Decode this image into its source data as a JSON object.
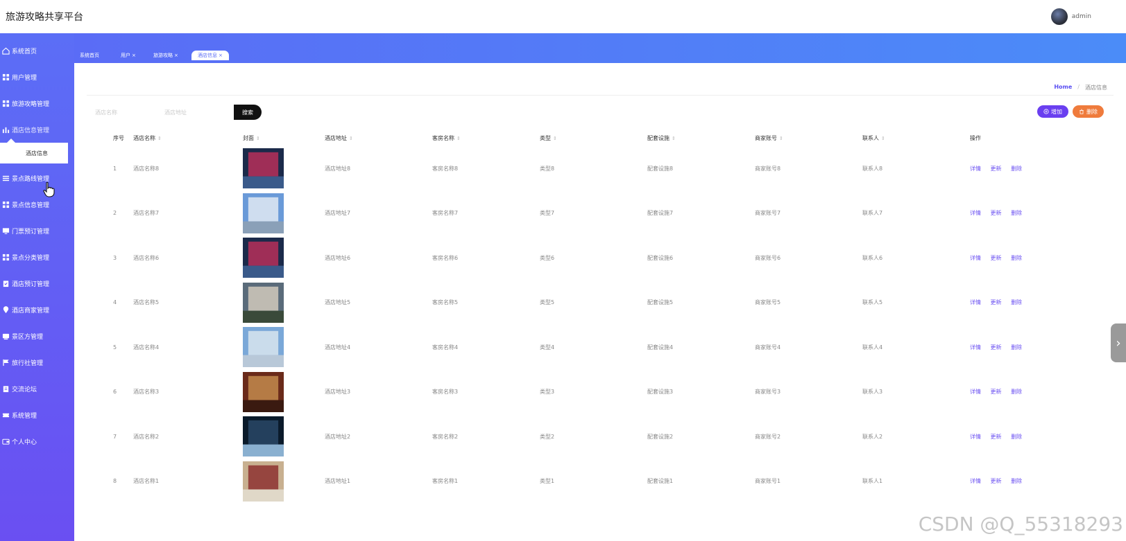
{
  "app": {
    "title": "旅游攻略共享平台",
    "user": "admin"
  },
  "sidebar": {
    "items": [
      {
        "label": "系统首页",
        "icon": "home-icon"
      },
      {
        "label": "用户管理",
        "icon": "grid-icon"
      },
      {
        "label": "旅游攻略管理",
        "icon": "grid-icon"
      },
      {
        "label": "酒店信息管理",
        "icon": "bar-chart-icon"
      },
      {
        "label": "景点路线管理",
        "icon": "list-icon"
      },
      {
        "label": "景点信息管理",
        "icon": "grid-icon"
      },
      {
        "label": "门票预订管理",
        "icon": "monitor-icon"
      },
      {
        "label": "景点分类管理",
        "icon": "grid-icon"
      },
      {
        "label": "酒店预订管理",
        "icon": "clipboard-icon"
      },
      {
        "label": "酒店商家管理",
        "icon": "location-icon"
      },
      {
        "label": "景区方管理",
        "icon": "card-icon"
      },
      {
        "label": "旅行社管理",
        "icon": "flag-icon"
      },
      {
        "label": "交流论坛",
        "icon": "clipboard-icon"
      },
      {
        "label": "系统管理",
        "icon": "ticket-icon"
      },
      {
        "label": "个人中心",
        "icon": "wallet-icon"
      }
    ],
    "submenu_label": "酒店信息"
  },
  "tabs": [
    {
      "label": "系统首页",
      "closable": false
    },
    {
      "label": "用户",
      "closable": true
    },
    {
      "label": "旅游攻略",
      "closable": true
    },
    {
      "label": "酒店信息",
      "closable": true,
      "active": true
    }
  ],
  "breadcrumb": {
    "home": "Home",
    "current": "酒店信息"
  },
  "search": {
    "name_placeholder": "酒店名称",
    "address_placeholder": "酒店地址",
    "button": "搜索"
  },
  "actions": {
    "add": "增加",
    "delete": "删除"
  },
  "table": {
    "headers": [
      "序号",
      "酒店名称",
      "封面",
      "酒店地址",
      "客房名称",
      "类型",
      "配套设施",
      "商家账号",
      "联系人",
      "操作"
    ],
    "ops": [
      "详情",
      "更新",
      "删除"
    ],
    "rows": [
      {
        "no": "1",
        "name": "酒店名称8",
        "address": "酒店地址8",
        "room": "客房名称8",
        "type": "类型8",
        "facility": "配套设施8",
        "account": "商家账号8",
        "contact": "联系人8"
      },
      {
        "no": "2",
        "name": "酒店名称7",
        "address": "酒店地址7",
        "room": "客房名称7",
        "type": "类型7",
        "facility": "配套设施7",
        "account": "商家账号7",
        "contact": "联系人7"
      },
      {
        "no": "3",
        "name": "酒店名称6",
        "address": "酒店地址6",
        "room": "客房名称6",
        "type": "类型6",
        "facility": "配套设施6",
        "account": "商家账号6",
        "contact": "联系人6"
      },
      {
        "no": "4",
        "name": "酒店名称5",
        "address": "酒店地址5",
        "room": "客房名称5",
        "type": "类型5",
        "facility": "配套设施5",
        "account": "商家账号5",
        "contact": "联系人5"
      },
      {
        "no": "5",
        "name": "酒店名称4",
        "address": "酒店地址4",
        "room": "客房名称4",
        "type": "类型4",
        "facility": "配套设施4",
        "account": "商家账号4",
        "contact": "联系人4"
      },
      {
        "no": "6",
        "name": "酒店名称3",
        "address": "酒店地址3",
        "room": "客房名称3",
        "type": "类型3",
        "facility": "配套设施3",
        "account": "商家账号3",
        "contact": "联系人3"
      },
      {
        "no": "7",
        "name": "酒店名称2",
        "address": "酒店地址2",
        "room": "客房名称2",
        "type": "类型2",
        "facility": "配套设施2",
        "account": "商家账号2",
        "contact": "联系人2"
      },
      {
        "no": "8",
        "name": "酒店名称1",
        "address": "酒店地址1",
        "room": "客房名称1",
        "type": "类型1",
        "facility": "配套设施1",
        "account": "商家账号1",
        "contact": "联系人1"
      }
    ]
  },
  "watermark": "CSDN @Q_55318293",
  "colors": {
    "sidebar_top": "#5b6ef6",
    "sidebar_bottom": "#6a4ff2",
    "accent": "#6a4ff2",
    "delete": "#ef7b3c"
  }
}
